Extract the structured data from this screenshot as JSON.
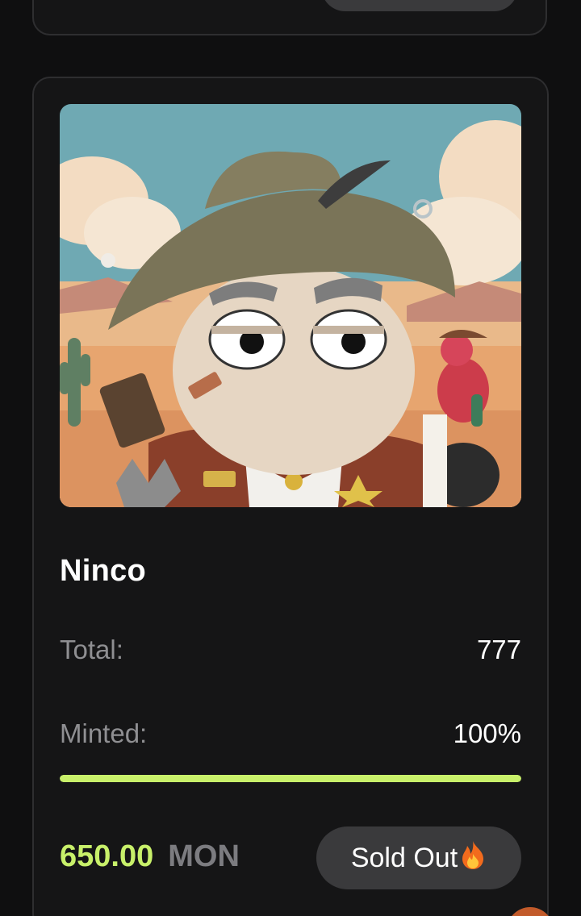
{
  "collection": {
    "name": "Ninco",
    "total_label": "Total:",
    "total_value": "777",
    "minted_label": "Minted:",
    "minted_value": "100%",
    "minted_fraction": 1.0,
    "price_amount": "650.00",
    "price_currency": "MON",
    "status_button": "Sold Out",
    "status_icon": "fire-icon"
  },
  "colors": {
    "accent": "#c8f06a",
    "card_bg": "#151516",
    "button_bg": "#3a3a3c"
  }
}
